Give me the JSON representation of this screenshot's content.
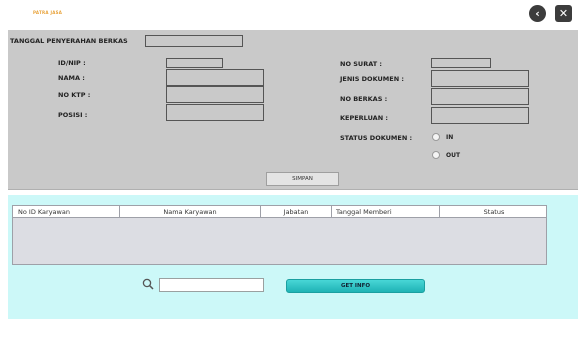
{
  "header": {
    "logo_text": "PATRA JASA"
  },
  "form": {
    "tanggal_label": "TANGGAL PENYERAHAN BERKAS",
    "left_fields": [
      {
        "label": "ID/NIP :"
      },
      {
        "label": "NAMA :"
      },
      {
        "label": "NO KTP :"
      },
      {
        "label": "POSISI :"
      }
    ],
    "right_fields": [
      {
        "label": "NO SURAT :"
      },
      {
        "label": "JENIS DOKUMEN :"
      },
      {
        "label": "NO BERKAS :"
      },
      {
        "label": "KEPERLUAN :"
      }
    ],
    "status_label": "STATUS DOKUMEN :",
    "status_options": [
      "IN",
      "OUT"
    ],
    "save_label": "SIMPAN"
  },
  "table": {
    "columns": [
      "No ID Karyawan",
      "Nama Karyawan",
      "Jabatan",
      "Tanggal Memberi",
      "Status"
    ],
    "rows": []
  },
  "search": {
    "value": "",
    "placeholder": ""
  },
  "get_info_label": "GET INFO",
  "colors": {
    "panel": "#c9c9c9",
    "lower_panel": "#ccf8f8",
    "button_accent": "#2bc4c6"
  }
}
